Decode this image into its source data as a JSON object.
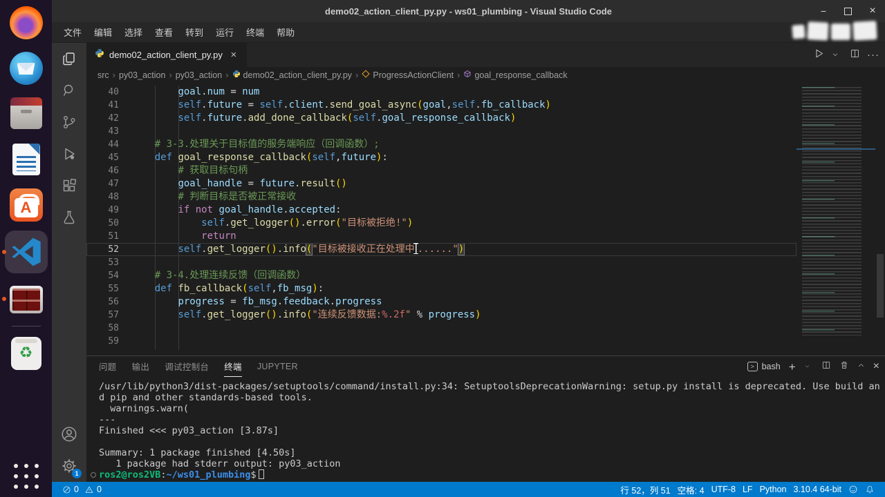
{
  "window": {
    "title": "demo02_action_client_py.py - ws01_plumbing - Visual Studio Code"
  },
  "menu_items": [
    "文件",
    "编辑",
    "选择",
    "查看",
    "转到",
    "运行",
    "终端",
    "帮助"
  ],
  "dock_apps": [
    {
      "name": "firefox",
      "running": false
    },
    {
      "name": "thunderbird",
      "running": false
    },
    {
      "name": "files",
      "running": false
    },
    {
      "name": "libreoffice-writer",
      "running": false
    },
    {
      "name": "ubuntu-software",
      "running": false
    },
    {
      "name": "vscode",
      "running": true,
      "active": true
    },
    {
      "name": "terminator",
      "running": true
    },
    {
      "name": "trash",
      "running": false
    },
    {
      "name": "app-grid",
      "running": false
    }
  ],
  "activity_bar": {
    "top": [
      "explorer",
      "search",
      "source-control",
      "run-and-debug",
      "extensions",
      "testing"
    ],
    "bottom": [
      "account",
      "settings"
    ],
    "settings_badge": "1"
  },
  "editor_tab": {
    "label": "demo02_action_client_py.py",
    "close": "×"
  },
  "breadcrumb": [
    {
      "label": "src"
    },
    {
      "label": "py03_action"
    },
    {
      "label": "py03_action"
    },
    {
      "label": "demo02_action_client_py.py",
      "icon": "python"
    },
    {
      "label": "ProgressActionClient",
      "icon": "class"
    },
    {
      "label": "goal_response_callback",
      "icon": "method"
    }
  ],
  "editor": {
    "current_line": 52,
    "lines": [
      {
        "n": 40,
        "tokens": [
          [
            "w",
            "        "
          ],
          [
            "v",
            "goal"
          ],
          [
            "w",
            "."
          ],
          [
            "v",
            "num"
          ],
          [
            "w",
            " = "
          ],
          [
            "v",
            "num"
          ]
        ]
      },
      {
        "n": 41,
        "tokens": [
          [
            "w",
            "        "
          ],
          [
            "sl",
            "self"
          ],
          [
            "w",
            "."
          ],
          [
            "v",
            "future"
          ],
          [
            "w",
            " = "
          ],
          [
            "sl",
            "self"
          ],
          [
            "w",
            "."
          ],
          [
            "v",
            "client"
          ],
          [
            "w",
            "."
          ],
          [
            "f",
            "send_goal_async"
          ],
          [
            "p",
            "("
          ],
          [
            "v",
            "goal"
          ],
          [
            "w",
            ","
          ],
          [
            "sl",
            "self"
          ],
          [
            "w",
            "."
          ],
          [
            "v",
            "fb_callback"
          ],
          [
            "p",
            ")"
          ]
        ]
      },
      {
        "n": 42,
        "tokens": [
          [
            "w",
            "        "
          ],
          [
            "sl",
            "self"
          ],
          [
            "w",
            "."
          ],
          [
            "v",
            "future"
          ],
          [
            "w",
            "."
          ],
          [
            "f",
            "add_done_callback"
          ],
          [
            "p",
            "("
          ],
          [
            "sl",
            "self"
          ],
          [
            "w",
            "."
          ],
          [
            "v",
            "goal_response_callback"
          ],
          [
            "p",
            ")"
          ]
        ]
      },
      {
        "n": 43,
        "tokens": []
      },
      {
        "n": 44,
        "tokens": [
          [
            "w",
            "    "
          ],
          [
            "c",
            "# 3-3.处理关于目标值的服务端响应（回调函数）;"
          ]
        ]
      },
      {
        "n": 45,
        "tokens": [
          [
            "w",
            "    "
          ],
          [
            "d",
            "def "
          ],
          [
            "f",
            "goal_response_callback"
          ],
          [
            "p",
            "("
          ],
          [
            "sl",
            "self"
          ],
          [
            "w",
            ","
          ],
          [
            "v",
            "future"
          ],
          [
            "p",
            ")"
          ],
          [
            "w",
            ":"
          ]
        ]
      },
      {
        "n": 46,
        "tokens": [
          [
            "w",
            "        "
          ],
          [
            "c",
            "# 获取目标句柄"
          ]
        ]
      },
      {
        "n": 47,
        "tokens": [
          [
            "w",
            "        "
          ],
          [
            "v",
            "goal_handle"
          ],
          [
            "w",
            " = "
          ],
          [
            "v",
            "future"
          ],
          [
            "w",
            "."
          ],
          [
            "f",
            "result"
          ],
          [
            "p",
            "("
          ],
          [
            "p",
            ")"
          ]
        ]
      },
      {
        "n": 48,
        "tokens": [
          [
            "w",
            "        "
          ],
          [
            "c",
            "# 判断目标是否被正常接收"
          ]
        ]
      },
      {
        "n": 49,
        "tokens": [
          [
            "w",
            "        "
          ],
          [
            "kw",
            "if"
          ],
          [
            "w",
            " "
          ],
          [
            "kw",
            "not"
          ],
          [
            "w",
            " "
          ],
          [
            "v",
            "goal_handle"
          ],
          [
            "w",
            "."
          ],
          [
            "v",
            "accepted"
          ],
          [
            "w",
            ":"
          ]
        ]
      },
      {
        "n": 50,
        "tokens": [
          [
            "w",
            "            "
          ],
          [
            "sl",
            "self"
          ],
          [
            "w",
            "."
          ],
          [
            "f",
            "get_logger"
          ],
          [
            "p",
            "("
          ],
          [
            "p",
            ")"
          ],
          [
            "w",
            "."
          ],
          [
            "f",
            "error"
          ],
          [
            "p",
            "("
          ],
          [
            "s",
            "\"目标被拒绝!\""
          ],
          [
            "p",
            ")"
          ]
        ]
      },
      {
        "n": 51,
        "tokens": [
          [
            "w",
            "            "
          ],
          [
            "kw",
            "return"
          ]
        ]
      },
      {
        "n": 52,
        "tokens": [
          [
            "w",
            "        "
          ],
          [
            "sl",
            "self"
          ],
          [
            "w",
            "."
          ],
          [
            "f",
            "get_logger"
          ],
          [
            "p",
            "("
          ],
          [
            "p",
            ")"
          ],
          [
            "w",
            "."
          ],
          [
            "f",
            "info"
          ],
          [
            "pb",
            "("
          ],
          [
            "s",
            "\"目标被接收正在处理中"
          ],
          [
            "cursor",
            ""
          ],
          [
            "s",
            "......\""
          ],
          [
            "pb",
            ")"
          ]
        ]
      },
      {
        "n": 53,
        "tokens": []
      },
      {
        "n": 54,
        "tokens": [
          [
            "w",
            "    "
          ],
          [
            "c",
            "# 3-4.处理连续反馈（回调函数）"
          ]
        ]
      },
      {
        "n": 55,
        "tokens": [
          [
            "w",
            "    "
          ],
          [
            "d",
            "def "
          ],
          [
            "f",
            "fb_callback"
          ],
          [
            "p",
            "("
          ],
          [
            "sl",
            "self"
          ],
          [
            "w",
            ","
          ],
          [
            "v",
            "fb_msg"
          ],
          [
            "p",
            ")"
          ],
          [
            "w",
            ":"
          ]
        ]
      },
      {
        "n": 56,
        "tokens": [
          [
            "w",
            "        "
          ],
          [
            "v",
            "progress"
          ],
          [
            "w",
            " = "
          ],
          [
            "v",
            "fb_msg"
          ],
          [
            "w",
            "."
          ],
          [
            "v",
            "feedback"
          ],
          [
            "w",
            "."
          ],
          [
            "v",
            "progress"
          ]
        ]
      },
      {
        "n": 57,
        "tokens": [
          [
            "w",
            "        "
          ],
          [
            "sl",
            "self"
          ],
          [
            "w",
            "."
          ],
          [
            "f",
            "get_logger"
          ],
          [
            "p",
            "("
          ],
          [
            "p",
            ")"
          ],
          [
            "w",
            "."
          ],
          [
            "f",
            "info"
          ],
          [
            "p",
            "("
          ],
          [
            "s",
            "\"连续反馈数据:"
          ],
          [
            "fmt",
            "%.2f"
          ],
          [
            "s",
            "\""
          ],
          [
            "w",
            " % "
          ],
          [
            "v",
            "progress"
          ],
          [
            "p",
            ")"
          ]
        ]
      },
      {
        "n": 58,
        "tokens": []
      },
      {
        "n": 59,
        "tokens": []
      }
    ]
  },
  "panel": {
    "tabs": [
      {
        "label": "问题",
        "active": false
      },
      {
        "label": "输出",
        "active": false
      },
      {
        "label": "调试控制台",
        "active": false
      },
      {
        "label": "终端",
        "active": true
      },
      {
        "label": "JUPYTER",
        "active": false
      }
    ],
    "shell_label": "bash",
    "terminal_lines": [
      {
        "text": "/usr/lib/python3/dist-packages/setuptools/command/install.py:34: SetuptoolsDeprecationWarning: setup.py install is deprecated. Use build an"
      },
      {
        "text": "d pip and other standards-based tools."
      },
      {
        "text": "  warnings.warn("
      },
      {
        "text": "---"
      },
      {
        "text": "Finished <<< py03_action [3.87s]"
      },
      {
        "text": ""
      },
      {
        "text": "Summary: 1 package finished [4.50s]"
      },
      {
        "text": "   1 package had stderr output: py03_action"
      },
      {
        "prompt": true,
        "user": "ros2@ros2VB",
        "separator": ":",
        "path": "~/ws01_plumbing",
        "symbol": "$"
      }
    ]
  },
  "status_bar": {
    "errors": "0",
    "warnings": "0",
    "right_items": [
      {
        "name": "cursor-position",
        "label": "行 52，列 51"
      },
      {
        "name": "indentation",
        "label": "空格: 4"
      },
      {
        "name": "encoding",
        "label": "UTF-8"
      },
      {
        "name": "eol",
        "label": "LF"
      },
      {
        "name": "language-mode",
        "label": "Python"
      },
      {
        "name": "python-interpreter",
        "label": "3.10.4 64-bit"
      }
    ]
  }
}
